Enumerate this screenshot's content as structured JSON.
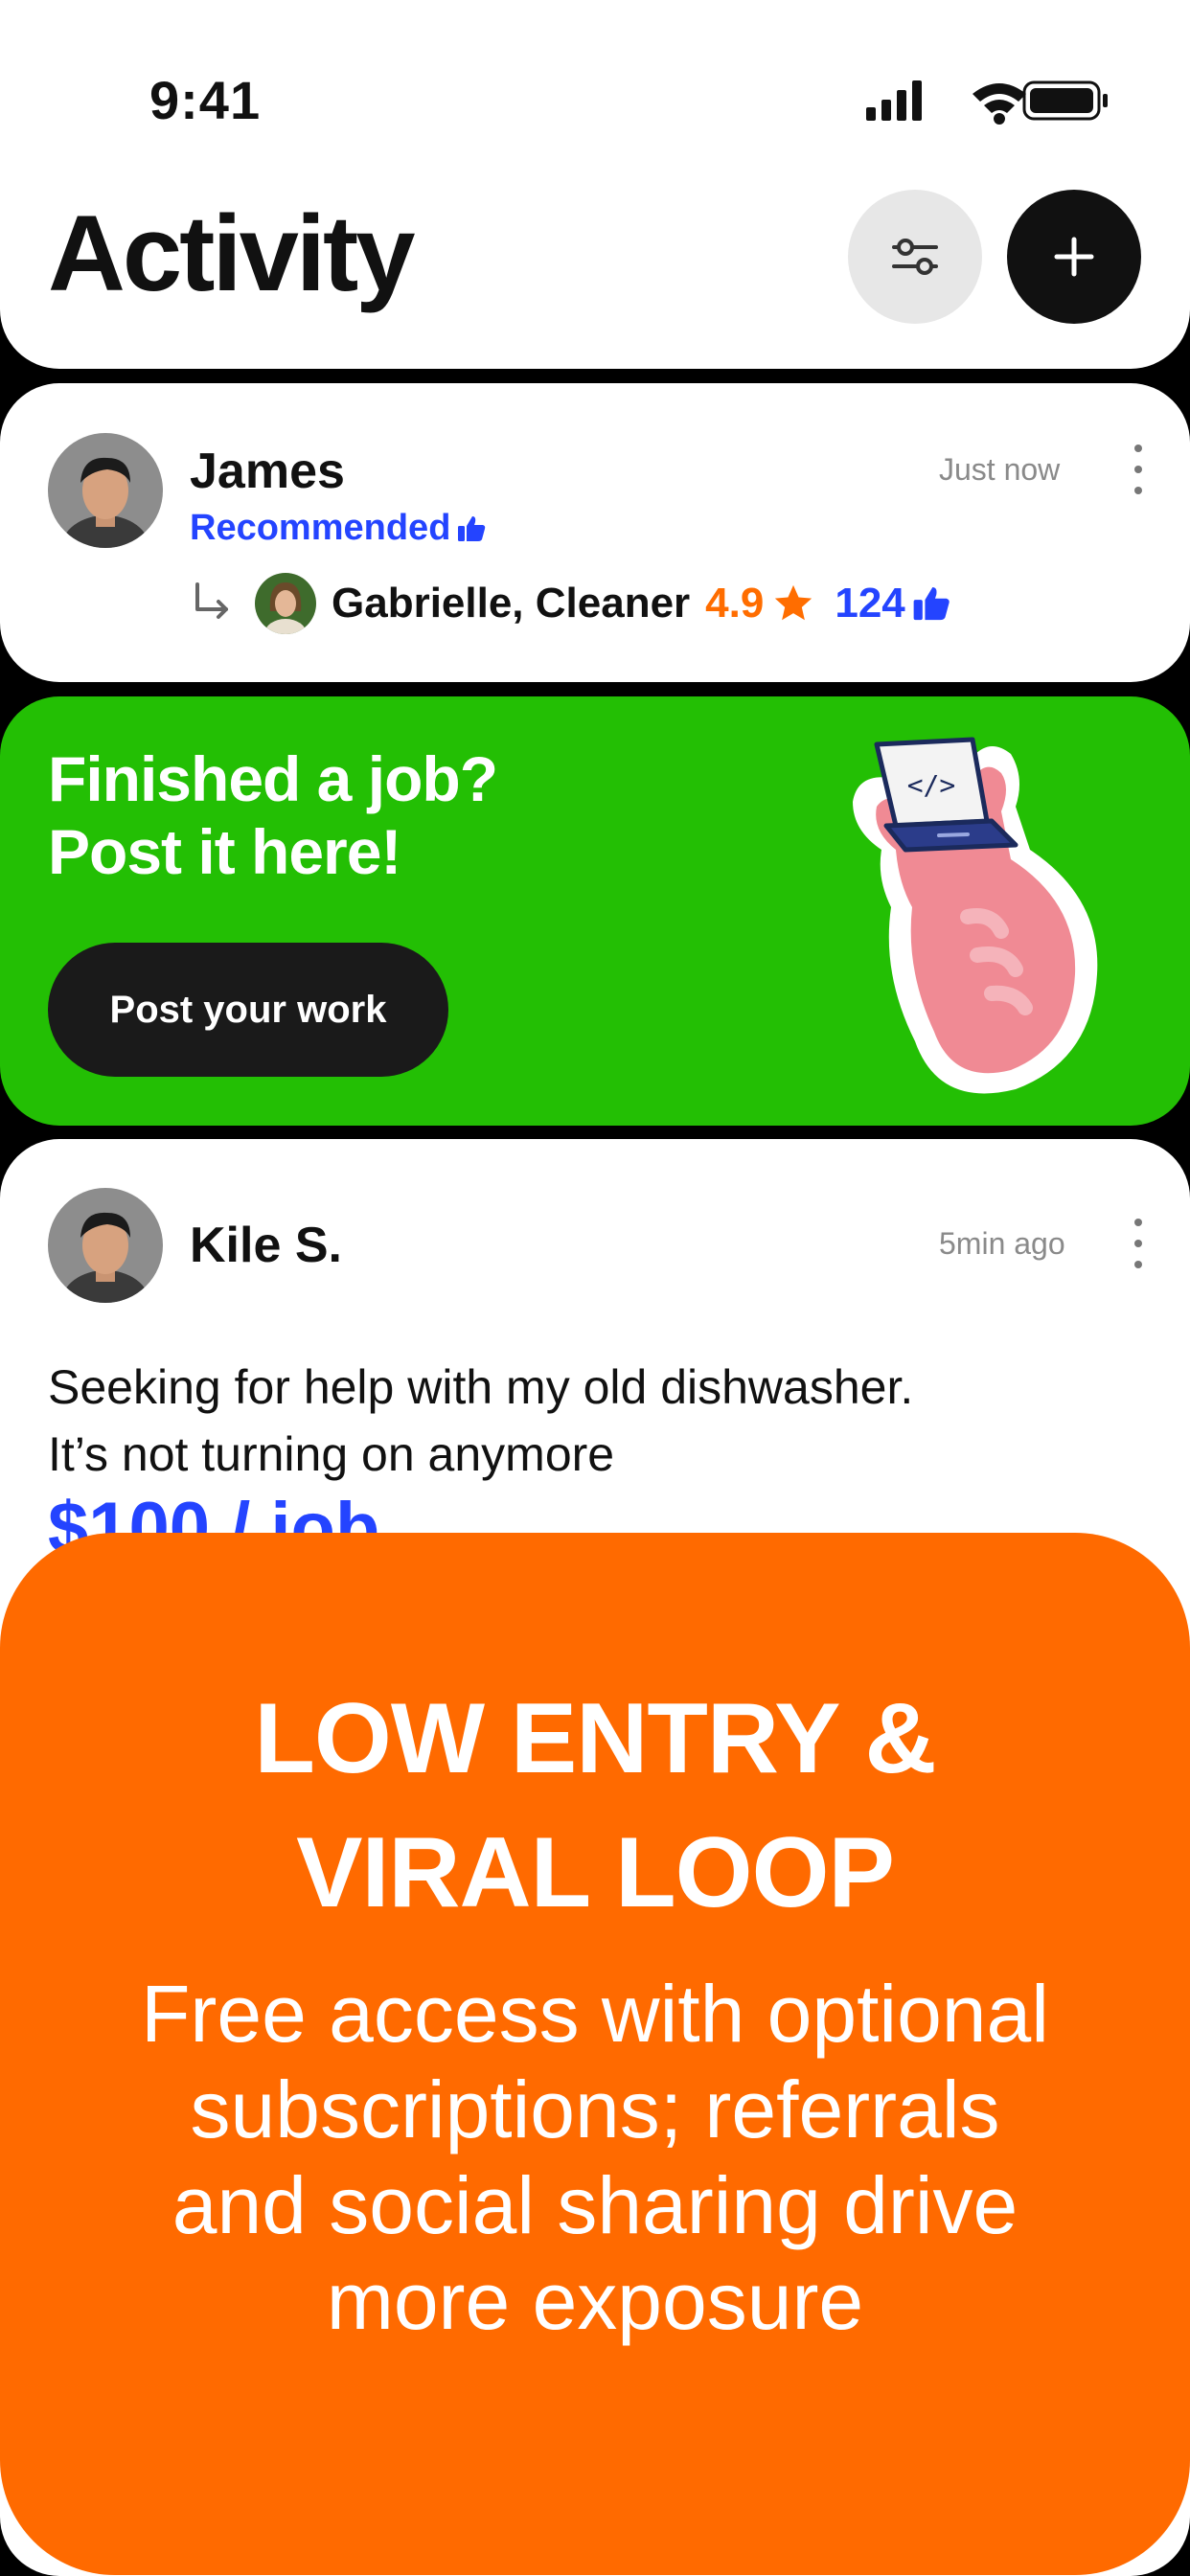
{
  "status_bar": {
    "time": "9:41"
  },
  "header": {
    "title": "Activity"
  },
  "feed": {
    "recommendation": {
      "user_name": "James",
      "time": "Just now",
      "label": "Recommended",
      "worker_name": "Gabrielle, Cleaner",
      "rating": "4.9",
      "likes": "124"
    },
    "promo": {
      "title_line1": "Finished a job?",
      "title_line2": "Post it here!",
      "button_label": "Post your work"
    },
    "request": {
      "user_name": "Kile S.",
      "time": "5min ago",
      "text_line1": "Seeking for help with my old dishwasher.",
      "text_line2": "It’s not turning on anymore",
      "price": "$100 / job"
    }
  },
  "overlay": {
    "title_line1": "LOW ENTRY &",
    "title_line2": "VIRAL LOOP",
    "body_line1": "Free access with optional",
    "body_line2": "subscriptions; referrals",
    "body_line3": "and social sharing drive",
    "body_line4": "more exposure"
  },
  "colors": {
    "accent_blue": "#2444ff",
    "accent_orange": "#ff6d00",
    "promo_green": "#23bf04",
    "overlay_orange": "#ff6a00"
  },
  "icons": [
    "signal-icon",
    "wifi-icon",
    "battery-icon",
    "filter-icon",
    "plus-icon",
    "more-vertical-icon",
    "thumbs-up-icon",
    "star-icon",
    "reply-arrow-icon",
    "laptop-hand-illustration"
  ]
}
